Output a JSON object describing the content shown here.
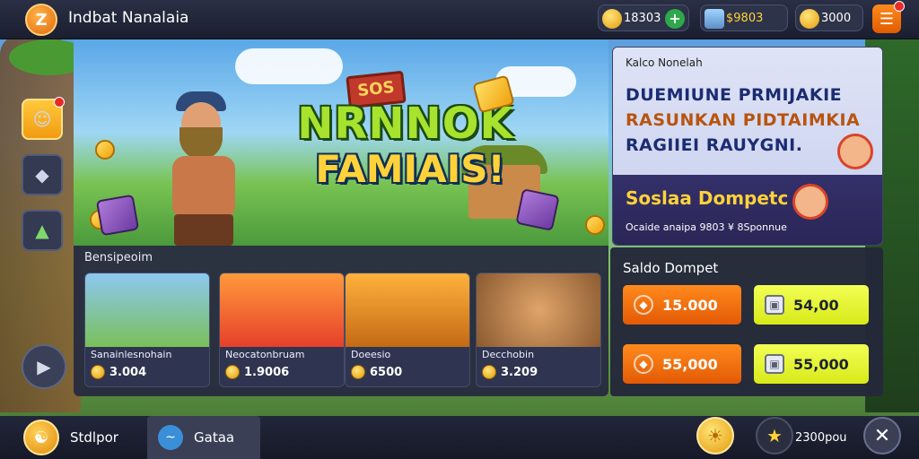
{
  "app": {
    "title": "Indbat Nanalaia",
    "logo_letter": "Z"
  },
  "header": {
    "currencies": [
      {
        "icon": "gold-heart-icon",
        "value": "18303"
      },
      {
        "icon": "trophy-icon",
        "value": "$9803"
      },
      {
        "icon": "coin-icon",
        "value": "3000"
      }
    ],
    "menu_icon": "menu-list-icon"
  },
  "hero": {
    "sign_text": "SOS",
    "title": "NRNNOK",
    "subtitle": "FAMIAIS!"
  },
  "promo": {
    "header": "Kalco Nonelah",
    "lines": [
      "DUEMIUNE PRMIJAKIE",
      "RASUNKAN PIDTAIMKIA",
      "RAGIIEI RAUYGNI."
    ],
    "wallet_title": "Soslaa Dompetc",
    "note": "Ocaide anaipa 9803 ¥ 8Sponnue"
  },
  "section": {
    "title": "Bensipeoim"
  },
  "cards": [
    {
      "name": "Sanainlesnohain",
      "price": "3.004"
    },
    {
      "name": "Neocatonbruam",
      "price": "1.9006"
    },
    {
      "name": "Doeesio",
      "price": "6500"
    },
    {
      "name": "Decchobin",
      "price": "3.209"
    }
  ],
  "saldo": {
    "title": "Saldo Dompet",
    "buttons": [
      {
        "value": "15.000",
        "style": "orange"
      },
      {
        "value": "54,00",
        "style": "yellow"
      },
      {
        "value": "55,000",
        "style": "orange"
      },
      {
        "value": "55,000",
        "style": "yellow"
      }
    ]
  },
  "bottom": {
    "left_label": "Stdlpor",
    "tab_label": "Gataa",
    "points": "2300pou",
    "colors": {
      "accent": "#ff8a1d",
      "yellow": "#e8f52a",
      "panel": "#282c3e"
    }
  }
}
